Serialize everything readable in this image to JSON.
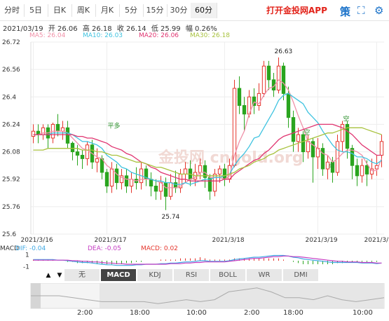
{
  "tabs": [
    {
      "label": "分时"
    },
    {
      "label": "5日"
    },
    {
      "label": "日K"
    },
    {
      "label": "周K"
    },
    {
      "label": "月K"
    },
    {
      "label": "5分"
    },
    {
      "label": "15分"
    },
    {
      "label": "30分"
    },
    {
      "label": "60分"
    }
  ],
  "active_tab": "60分",
  "app_link": "打开金投网APP",
  "toolbar_icons": [
    "strategy-icon",
    "fullscreen-icon",
    "settings-icon"
  ],
  "toolbar_glyphs": {
    "strategy": "策",
    "fullscreen": "⛶",
    "settings": "⚙"
  },
  "info": {
    "date": "2021/03/19",
    "open": "开 26.06",
    "high": "高 26.18",
    "close": "收 26.14",
    "low": "低 25.99",
    "change": "幅 0.26%"
  },
  "ma_legend": {
    "ma5": "MA5: 26.04",
    "ma10": "MA10: 26.03",
    "ma20": "MA20: 26.06",
    "ma30": "MA30: 26.18"
  },
  "macd_legend": {
    "macd": "MACD",
    "dif": "DIF: -0.04",
    "dea": "DEA: -0.05",
    "macd_val": "MACD: 0.02"
  },
  "colors": {
    "up": "#e5352c",
    "down": "#2aa51f",
    "ma5": "#f090a8",
    "ma10": "#3fc3e0",
    "ma20": "#e03470",
    "ma30": "#a8c23e",
    "dif": "#3da7e3",
    "dea": "#c43cc2"
  },
  "indicator_tabs": [
    "无",
    "MACD",
    "KDJ",
    "RSI",
    "BOLL",
    "WR",
    "DMI"
  ],
  "indicator_active": "MACD",
  "nav_arrows": [
    "▲",
    "▼"
  ],
  "nav_labels": [
    "2:00",
    "18:00",
    "10:00",
    "2:00",
    "18:00",
    "10:00"
  ],
  "watermark": "金投网 cngold.org",
  "chart_data": {
    "type": "candlestick",
    "y_ticks": [
      "26.72",
      "26.56",
      "26.4",
      "26.24",
      "26.08",
      "25.92",
      "25.76",
      "25.6"
    ],
    "ylim": [
      25.6,
      26.72
    ],
    "x_labels": [
      {
        "label": "2021/3/16",
        "index": 0
      },
      {
        "label": "2021/3/17",
        "index": 15
      },
      {
        "label": "2021/3/18",
        "index": 39
      },
      {
        "label": "2021/3/19",
        "index": 58
      },
      {
        "label": "2021/3/19",
        "index": 70
      }
    ],
    "annotations": [
      {
        "text": "26.63",
        "index": 50,
        "value": 26.63,
        "kind": "high"
      },
      {
        "text": "25.74",
        "index": 27,
        "value": 25.74,
        "kind": "low"
      },
      {
        "text": "平多",
        "index": 16,
        "value": 26.22
      },
      {
        "text": "空",
        "index": 56,
        "value": 26.18
      },
      {
        "text": "空",
        "index": 64,
        "value": 26.26
      },
      {
        "text": "平",
        "index": 61,
        "value": 25.98
      }
    ],
    "candles": [
      [
        26.17,
        26.2,
        26.24,
        26.13
      ],
      [
        26.2,
        26.18,
        26.24,
        26.13
      ],
      [
        26.18,
        26.22,
        26.24,
        26.15
      ],
      [
        26.22,
        26.16,
        26.24,
        26.1
      ],
      [
        26.16,
        26.24,
        26.25,
        26.13
      ],
      [
        26.24,
        26.2,
        26.3,
        26.17
      ],
      [
        26.2,
        26.22,
        26.26,
        26.15
      ],
      [
        26.22,
        26.13,
        26.26,
        26.1
      ],
      [
        26.13,
        26.08,
        26.14,
        26.03
      ],
      [
        26.08,
        26.06,
        26.12,
        26.0
      ],
      [
        26.06,
        26.04,
        26.09,
        25.98
      ],
      [
        26.04,
        26.12,
        26.14,
        26.0
      ],
      [
        26.12,
        26.02,
        26.15,
        25.98
      ],
      [
        26.02,
        26.04,
        26.1,
        25.96
      ],
      [
        26.04,
        25.96,
        26.06,
        25.92
      ],
      [
        25.96,
        25.88,
        25.98,
        25.84
      ],
      [
        25.88,
        25.98,
        26.02,
        25.84
      ],
      [
        25.98,
        25.9,
        26.01,
        25.86
      ],
      [
        25.9,
        25.94,
        25.98,
        25.86
      ],
      [
        25.94,
        25.88,
        25.98,
        25.84
      ],
      [
        25.88,
        25.92,
        25.96,
        25.84
      ],
      [
        25.92,
        25.9,
        25.99,
        25.86
      ],
      [
        25.9,
        25.98,
        26.02,
        25.86
      ],
      [
        25.98,
        25.92,
        26.0,
        25.88
      ],
      [
        25.92,
        25.88,
        25.96,
        25.82
      ],
      [
        25.88,
        25.85,
        25.92,
        25.8
      ],
      [
        25.85,
        25.9,
        25.94,
        25.8
      ],
      [
        25.9,
        25.82,
        25.93,
        25.74
      ],
      [
        25.82,
        25.9,
        25.95,
        25.8
      ],
      [
        25.9,
        25.87,
        25.97,
        25.84
      ],
      [
        25.87,
        25.95,
        25.98,
        25.84
      ],
      [
        25.95,
        25.98,
        26.02,
        25.9
      ],
      [
        25.98,
        25.92,
        26.03,
        25.88
      ],
      [
        25.92,
        25.96,
        26.01,
        25.88
      ],
      [
        25.96,
        26.0,
        26.04,
        25.92
      ],
      [
        26.0,
        25.93,
        26.03,
        25.87
      ],
      [
        25.93,
        25.85,
        25.95,
        25.8
      ],
      [
        25.85,
        25.95,
        25.98,
        25.82
      ],
      [
        25.95,
        25.98,
        26.0,
        25.9
      ],
      [
        25.98,
        25.92,
        26.01,
        25.88
      ],
      [
        25.92,
        26.0,
        26.04,
        25.9
      ],
      [
        26.0,
        26.45,
        26.5,
        25.99
      ],
      [
        26.45,
        26.35,
        26.52,
        26.3
      ],
      [
        26.35,
        26.3,
        26.4,
        26.2
      ],
      [
        26.3,
        26.4,
        26.44,
        26.28
      ],
      [
        26.4,
        26.35,
        26.45,
        26.3
      ],
      [
        26.35,
        26.42,
        26.48,
        26.32
      ],
      [
        26.42,
        26.58,
        26.61,
        26.4
      ],
      [
        26.58,
        26.5,
        26.61,
        26.44
      ],
      [
        26.5,
        26.44,
        26.54,
        26.4
      ],
      [
        26.44,
        26.58,
        26.63,
        26.42
      ],
      [
        26.58,
        26.42,
        26.6,
        26.38
      ],
      [
        26.42,
        26.28,
        26.46,
        26.22
      ],
      [
        26.28,
        26.14,
        26.32,
        26.08
      ],
      [
        26.14,
        26.18,
        26.22,
        26.08
      ],
      [
        26.18,
        26.08,
        26.2,
        26.02
      ],
      [
        26.08,
        26.14,
        26.18,
        26.04
      ],
      [
        26.14,
        26.05,
        26.16,
        25.9
      ],
      [
        26.05,
        26.1,
        26.16,
        25.98
      ],
      [
        26.1,
        25.98,
        26.13,
        25.94
      ],
      [
        25.98,
        26.02,
        26.06,
        25.92
      ],
      [
        26.02,
        25.96,
        26.05,
        25.9
      ],
      [
        25.96,
        26.14,
        26.18,
        25.94
      ],
      [
        26.14,
        26.24,
        26.26,
        26.08
      ],
      [
        26.24,
        26.1,
        26.26,
        26.04
      ],
      [
        26.1,
        26.0,
        26.12,
        25.92
      ],
      [
        26.0,
        25.94,
        26.04,
        25.88
      ],
      [
        25.94,
        26.0,
        26.04,
        25.9
      ],
      [
        26.0,
        25.95,
        26.03,
        25.88
      ],
      [
        25.95,
        25.98,
        26.04,
        25.92
      ],
      [
        25.98,
        26.0,
        26.06,
        25.94
      ],
      [
        26.06,
        26.14,
        26.18,
        25.99
      ]
    ],
    "series": [
      {
        "name": "MA5",
        "values": [
          26.18,
          26.18,
          26.19,
          26.19,
          26.2,
          26.2,
          26.2,
          26.19,
          26.16,
          26.13,
          26.1,
          26.09,
          26.07,
          26.05,
          26.04,
          26.0,
          25.98,
          25.95,
          25.93,
          25.92,
          25.92,
          25.91,
          25.92,
          25.92,
          25.92,
          25.91,
          25.9,
          25.87,
          25.87,
          25.87,
          25.88,
          25.9,
          25.92,
          25.93,
          25.96,
          25.96,
          25.93,
          25.93,
          25.93,
          25.92,
          25.94,
          26.06,
          26.14,
          26.2,
          26.3,
          26.37,
          26.36,
          26.41,
          26.45,
          26.46,
          26.5,
          26.48,
          26.44,
          26.37,
          26.29,
          26.22,
          26.14,
          26.12,
          26.1,
          26.07,
          26.06,
          26.02,
          26.04,
          26.07,
          26.09,
          26.09,
          26.08,
          26.06,
          26.01,
          25.97,
          25.97,
          26.04
        ]
      },
      {
        "name": "MA10",
        "values": [
          26.18,
          26.18,
          26.18,
          26.18,
          26.19,
          26.19,
          26.19,
          26.19,
          26.18,
          26.16,
          26.14,
          26.14,
          26.13,
          26.12,
          26.1,
          26.06,
          26.04,
          26.02,
          25.99,
          25.98,
          25.96,
          25.95,
          25.94,
          25.93,
          25.92,
          25.91,
          25.91,
          25.9,
          25.9,
          25.89,
          25.89,
          25.9,
          25.89,
          25.9,
          25.91,
          25.92,
          25.92,
          25.93,
          25.93,
          25.94,
          25.95,
          26.0,
          26.04,
          26.07,
          26.11,
          26.16,
          26.17,
          26.22,
          26.27,
          26.32,
          26.38,
          26.41,
          26.42,
          26.4,
          26.38,
          26.36,
          26.31,
          26.28,
          26.25,
          26.2,
          26.16,
          26.12,
          26.09,
          26.08,
          26.08,
          26.07,
          26.05,
          26.05,
          26.04,
          26.02,
          26.01,
          26.03
        ]
      },
      {
        "name": "MA20",
        "values": [
          26.18,
          26.18,
          26.18,
          26.18,
          26.18,
          26.18,
          26.18,
          26.18,
          26.18,
          26.17,
          26.17,
          26.16,
          26.16,
          26.15,
          26.14,
          26.13,
          26.11,
          26.1,
          26.09,
          26.07,
          26.06,
          26.04,
          26.02,
          26.01,
          25.99,
          25.98,
          25.96,
          25.95,
          25.94,
          25.93,
          25.92,
          25.92,
          25.91,
          25.91,
          25.91,
          25.91,
          25.91,
          25.91,
          25.91,
          25.92,
          25.92,
          25.95,
          25.97,
          25.99,
          26.01,
          26.03,
          26.04,
          26.07,
          26.09,
          26.12,
          26.15,
          26.17,
          26.18,
          26.19,
          26.2,
          26.21,
          26.22,
          26.23,
          26.24,
          26.24,
          26.24,
          26.24,
          26.23,
          26.22,
          26.2,
          26.18,
          26.15,
          26.12,
          26.1,
          26.08,
          26.06,
          26.06
        ]
      },
      {
        "name": "MA30",
        "values": [
          26.09,
          26.09,
          26.09,
          26.1,
          26.1,
          26.1,
          26.1,
          26.1,
          26.1,
          26.1,
          26.09,
          26.09,
          26.09,
          26.08,
          26.08,
          26.07,
          26.06,
          26.06,
          26.05,
          26.04,
          26.03,
          26.02,
          26.02,
          26.01,
          26.0,
          25.99,
          25.99,
          25.98,
          25.97,
          25.96,
          25.95,
          25.95,
          25.95,
          25.94,
          25.94,
          25.94,
          25.94,
          25.94,
          25.94,
          25.94,
          25.95,
          25.96,
          25.98,
          25.99,
          26.0,
          26.02,
          26.03,
          26.04,
          26.06,
          26.07,
          26.09,
          26.1,
          26.11,
          26.12,
          26.13,
          26.14,
          26.15,
          26.16,
          26.17,
          26.18,
          26.19,
          26.19,
          26.2,
          26.21,
          26.22,
          26.22,
          26.22,
          26.22,
          26.21,
          26.2,
          26.19,
          26.18
        ]
      }
    ],
    "macd": {
      "ylim": [
        -1.2,
        1.2
      ],
      "y_ticks": [
        "1",
        "-1"
      ],
      "dif": [
        0.2,
        0.2,
        0.2,
        0.2,
        0.2,
        0.1,
        0.1,
        0.0,
        -0.1,
        -0.2,
        -0.3,
        -0.3,
        -0.4,
        -0.5,
        -0.6,
        -0.7,
        -0.7,
        -0.8,
        -0.8,
        -0.8,
        -0.8,
        -0.7,
        -0.7,
        -0.6,
        -0.6,
        -0.6,
        -0.5,
        -0.5,
        -0.4,
        -0.4,
        -0.3,
        -0.2,
        -0.2,
        -0.1,
        0.0,
        0.0,
        -0.1,
        -0.1,
        -0.1,
        -0.1,
        0.0,
        0.2,
        0.3,
        0.4,
        0.5,
        0.6,
        0.6,
        0.7,
        0.8,
        0.9,
        0.9,
        0.9,
        0.8,
        0.6,
        0.5,
        0.3,
        0.2,
        0.1,
        0.0,
        -0.1,
        -0.2,
        -0.3,
        -0.3,
        -0.3,
        -0.3,
        -0.3,
        -0.3,
        -0.4,
        -0.4,
        -0.4,
        -0.5,
        -0.4
      ],
      "dea": [
        0.1,
        0.1,
        0.1,
        0.1,
        0.1,
        0.1,
        0.1,
        0.1,
        0.0,
        0.0,
        -0.1,
        -0.1,
        -0.2,
        -0.2,
        -0.3,
        -0.4,
        -0.4,
        -0.5,
        -0.5,
        -0.6,
        -0.6,
        -0.6,
        -0.6,
        -0.6,
        -0.6,
        -0.6,
        -0.6,
        -0.6,
        -0.5,
        -0.5,
        -0.5,
        -0.4,
        -0.4,
        -0.3,
        -0.3,
        -0.2,
        -0.2,
        -0.2,
        -0.2,
        -0.2,
        -0.1,
        0.0,
        0.1,
        0.2,
        0.3,
        0.4,
        0.4,
        0.5,
        0.6,
        0.7,
        0.7,
        0.8,
        0.8,
        0.7,
        0.7,
        0.6,
        0.5,
        0.4,
        0.3,
        0.2,
        0.1,
        0.0,
        -0.1,
        -0.1,
        -0.2,
        -0.2,
        -0.2,
        -0.3,
        -0.3,
        -0.3,
        -0.4,
        -0.4
      ]
    },
    "navigator_values": [
      26.2,
      26.2,
      26.2,
      26.1,
      26.0,
      25.9,
      25.9,
      25.9,
      25.9,
      25.8,
      25.9,
      26.0,
      25.9,
      26.0,
      26.4,
      26.5,
      26.6,
      26.4,
      26.1,
      26.1,
      26.0,
      26.2,
      26.0,
      25.9,
      26.0,
      26.1
    ]
  }
}
